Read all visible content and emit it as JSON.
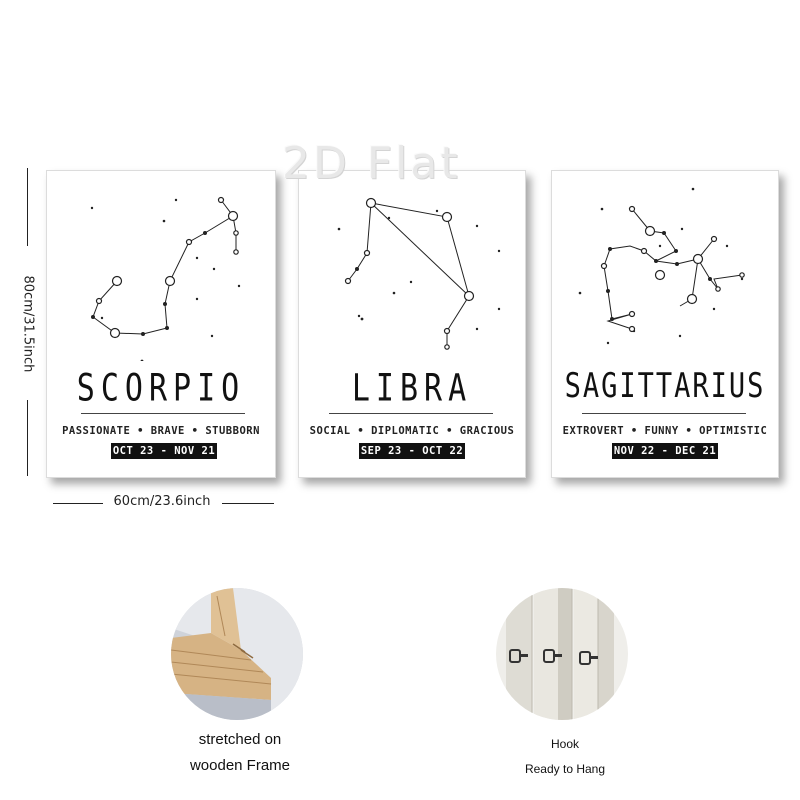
{
  "watermark": "2D Flat",
  "posters": [
    {
      "name": "SCORPIO",
      "traits": "PASSIONATE • BRAVE • STUBBORN",
      "dates": "OCT 23 - NOV 21"
    },
    {
      "name": "LIBRA",
      "traits": "SOCIAL • DIPLOMATIC • GRACIOUS",
      "dates": "SEP 23 - OCT 22"
    },
    {
      "name": "SAGITTARIUS",
      "traits": "EXTROVERT • FUNNY • OPTIMISTIC",
      "dates": "NOV 22 - DEC 21"
    }
  ],
  "dimensions": {
    "height": "80cm/31.5inch",
    "width": "60cm/23.6inch"
  },
  "features": [
    {
      "line1": "stretched on",
      "line2": "wooden Frame"
    },
    {
      "line1": "Hook",
      "line2": "Ready to Hang"
    }
  ],
  "colors": {
    "ink": "#111111",
    "frame_wood": "#d9b98c",
    "paper": "#ffffff"
  }
}
